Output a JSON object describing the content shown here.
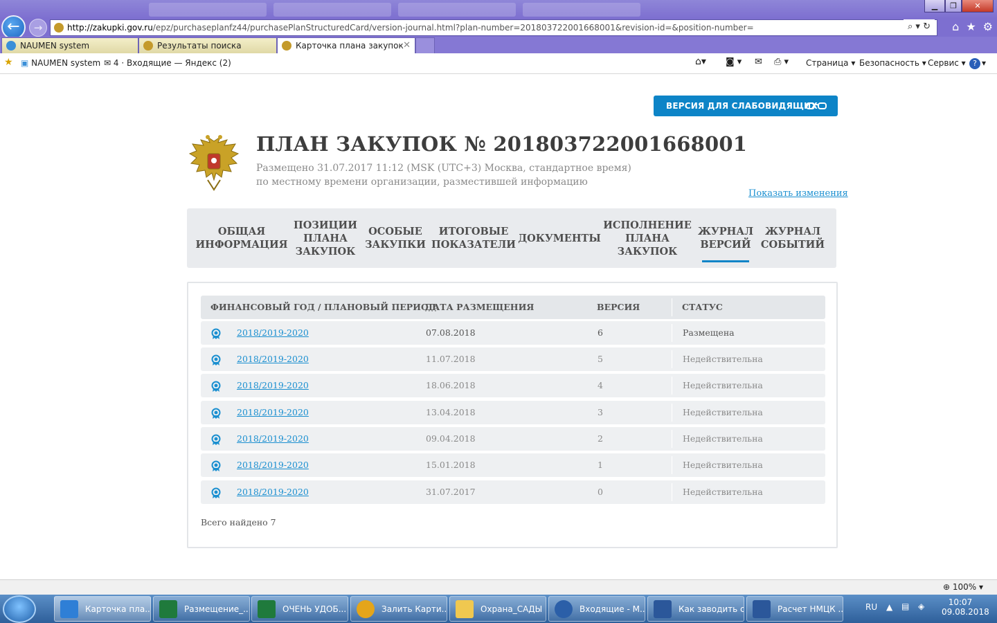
{
  "browser": {
    "url_domain": "http://zakupki.gov.ru",
    "url_path": "/epz/purchaseplanfz44/purchasePlanStructuredCard/version-journal.html?plan-number=201803722001668001&revision-id=&position-number=",
    "tabs": [
      {
        "label": "NAUMEN system"
      },
      {
        "label": "Результаты поиска"
      },
      {
        "label": "Карточка плана закупок"
      }
    ],
    "favorites": [
      {
        "label": "NAUMEN system"
      },
      {
        "label": "4 · Входящие — Яндекс (2)"
      }
    ],
    "commands": {
      "page": "Страница",
      "safety": "Безопасность",
      "service": "Сервис"
    },
    "zoom": "100%"
  },
  "page": {
    "vision_button": "ВЕРСИЯ ДЛЯ СЛАБОВИДЯЩИХ",
    "title": "ПЛАН ЗАКУПОК № 201803722001668001",
    "subtitle1": "Размещено 31.07.2017 11:12 (MSK (UTC+3) Москва, стандартное время)",
    "subtitle2": "по местному времени организации, разместившей информацию",
    "changes_link": "Показать изменения",
    "nav_tabs": [
      {
        "label": "ОБЩАЯ\nИНФОРМАЦИЯ"
      },
      {
        "label": "ПОЗИЦИИ\nПЛАНА\nЗАКУПОК"
      },
      {
        "label": "ОСОБЫЕ\nЗАКУПКИ"
      },
      {
        "label": "ИТОГОВЫЕ\nПОКАЗАТЕЛИ"
      },
      {
        "label": "ДОКУМЕНТЫ"
      },
      {
        "label": "ИСПОЛНЕНИЕ\nПЛАНА\nЗАКУПОК"
      },
      {
        "label": "ЖУРНАЛ\nВЕРСИЙ"
      },
      {
        "label": "ЖУРНАЛ\nСОБЫТИЙ"
      }
    ],
    "table": {
      "headers": [
        "ФИНАНСОВЫЙ ГОД / ПЛАНОВЫЙ ПЕРИОД",
        "ДАТА РАЗМЕЩЕНИЯ",
        "ВЕРСИЯ",
        "СТАТУС"
      ],
      "rows": [
        {
          "period": "2018/2019-2020",
          "date": "07.08.2018",
          "version": "6",
          "status": "Размещена"
        },
        {
          "period": "2018/2019-2020",
          "date": "11.07.2018",
          "version": "5",
          "status": "Недействительна"
        },
        {
          "period": "2018/2019-2020",
          "date": "18.06.2018",
          "version": "4",
          "status": "Недействительна"
        },
        {
          "period": "2018/2019-2020",
          "date": "13.04.2018",
          "version": "3",
          "status": "Недействительна"
        },
        {
          "period": "2018/2019-2020",
          "date": "09.04.2018",
          "version": "2",
          "status": "Недействительна"
        },
        {
          "period": "2018/2019-2020",
          "date": "15.01.2018",
          "version": "1",
          "status": "Недействительна"
        },
        {
          "period": "2018/2019-2020",
          "date": "31.07.2017",
          "version": "0",
          "status": "Недействительна"
        }
      ]
    },
    "total": "Всего найдено 7"
  },
  "taskbar": {
    "items": [
      {
        "label": "Карточка пла..."
      },
      {
        "label": "Размещение_..."
      },
      {
        "label": "ОЧЕНЬ УДОБ..."
      },
      {
        "label": "Залить Карти..."
      },
      {
        "label": "Охрана_САДЫ"
      },
      {
        "label": "Входящие - М..."
      },
      {
        "label": "Как заводить с..."
      },
      {
        "label": "Расчет НМЦК ..."
      }
    ],
    "lang": "RU",
    "time": "10:07",
    "date": "09.08.2018"
  }
}
